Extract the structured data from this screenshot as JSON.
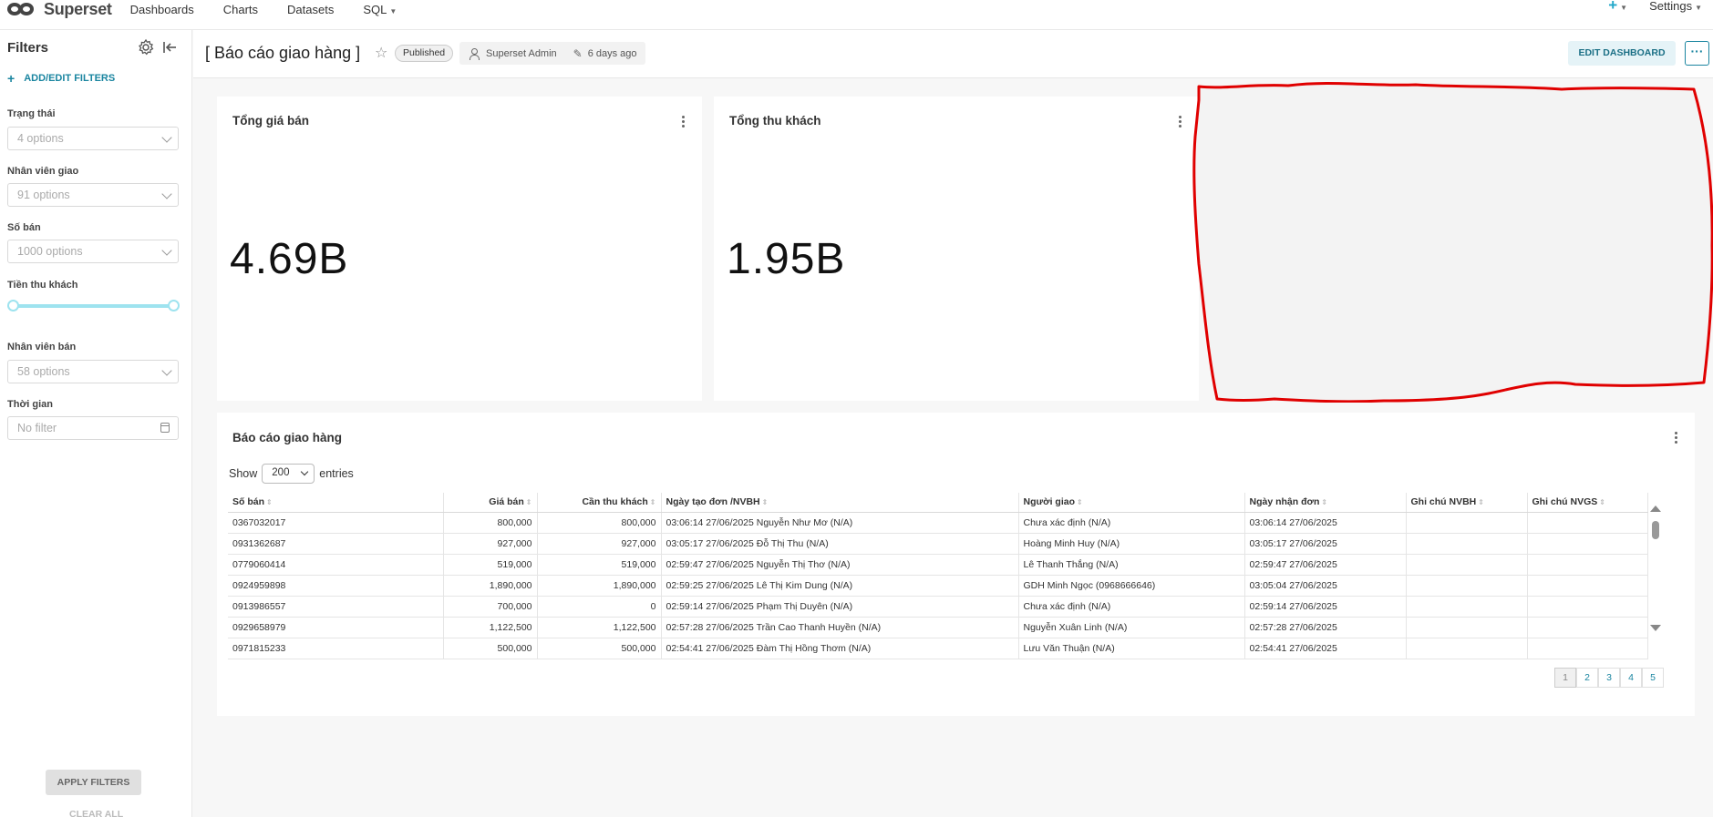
{
  "nav": {
    "brand": "Superset",
    "links": [
      "Dashboards",
      "Charts",
      "Datasets",
      "SQL"
    ],
    "plus": "+",
    "settings": "Settings"
  },
  "sidebar": {
    "title": "Filters",
    "add_edit": "ADD/EDIT FILTERS",
    "filters": [
      {
        "label": "Trạng thái",
        "value": "4 options"
      },
      {
        "label": "Nhân viên giao",
        "value": "91 options"
      },
      {
        "label": "Số bán",
        "value": "1000 options"
      },
      {
        "label": "Tiền thu khách",
        "value": ""
      },
      {
        "label": "Nhân viên bán",
        "value": "58 options"
      },
      {
        "label": "Thời gian",
        "value": "No filter"
      }
    ],
    "apply": "APPLY FILTERS",
    "clear": "CLEAR ALL"
  },
  "header": {
    "title": "[ Báo cáo giao hàng ]",
    "status": "Published",
    "owner": "Superset Admin",
    "modified": "6 days ago",
    "edit": "EDIT DASHBOARD",
    "more": "···"
  },
  "cards": [
    {
      "title": "Tổng giá bán",
      "value": "4.69B"
    },
    {
      "title": "Tổng thu khách",
      "value": "1.95B"
    }
  ],
  "table_card": {
    "title": "Báo cáo giao hàng",
    "show_label": "Show",
    "show_value": "200",
    "entries_label": "entries",
    "columns": [
      "Số bán",
      "Giá bán",
      "Cần thu khách",
      "Ngày tạo đơn /NVBH",
      "Người giao",
      "Ngày nhận đơn",
      "Ghi chú NVBH",
      "Ghi chú NVGS"
    ],
    "rows": [
      [
        "0367032017",
        "800,000",
        "800,000",
        "03:06:14 27/06/2025 Nguyễn Như Mơ (N/A)",
        "Chưa xác định (N/A)",
        "03:06:14 27/06/2025",
        "",
        ""
      ],
      [
        "0931362687",
        "927,000",
        "927,000",
        "03:05:17 27/06/2025 Đỗ Thị Thu (N/A)",
        "Hoàng Minh Huy (N/A)",
        "03:05:17 27/06/2025",
        "",
        ""
      ],
      [
        "0779060414",
        "519,000",
        "519,000",
        "02:59:47 27/06/2025 Nguyễn Thị Thơ (N/A)",
        "Lê Thanh Thắng (N/A)",
        "02:59:47 27/06/2025",
        "",
        ""
      ],
      [
        "0924959898",
        "1,890,000",
        "1,890,000",
        "02:59:25 27/06/2025 Lê Thị Kim Dung (N/A)",
        "GDH Minh Ngọc (0968666646)",
        "03:05:04 27/06/2025",
        "",
        ""
      ],
      [
        "0913986557",
        "700,000",
        "0",
        "02:59:14 27/06/2025 Phạm Thị Duyên (N/A)",
        "Chưa xác định (N/A)",
        "02:59:14 27/06/2025",
        "",
        ""
      ],
      [
        "0929658979",
        "1,122,500",
        "1,122,500",
        "02:57:28 27/06/2025 Trần Cao Thanh Huyền (N/A)",
        "Nguyễn Xuân Linh (N/A)",
        "02:57:28 27/06/2025",
        "",
        ""
      ],
      [
        "0971815233",
        "500,000",
        "500,000",
        "02:54:41 27/06/2025 Đàm Thị Hồng Thơm (N/A)",
        "Lưu Văn Thuận (N/A)",
        "02:54:41 27/06/2025",
        "",
        ""
      ]
    ],
    "pages": [
      "1",
      "2",
      "3",
      "4",
      "5"
    ],
    "current_page": "1"
  },
  "colors": {
    "accent": "#20a7c9",
    "annotation": "#e00000"
  }
}
